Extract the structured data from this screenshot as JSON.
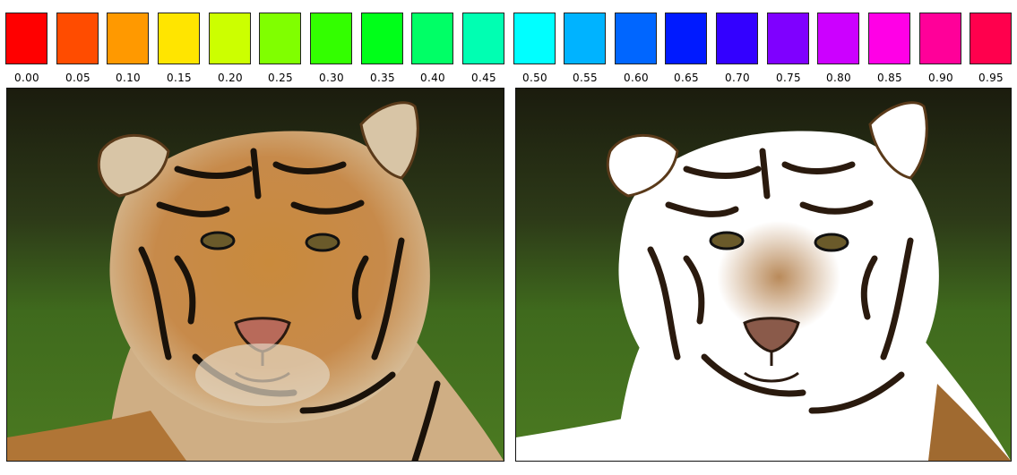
{
  "hue_swatches": [
    {
      "label": "0.00",
      "color": "#ff0000"
    },
    {
      "label": "0.05",
      "color": "#ff4c00"
    },
    {
      "label": "0.10",
      "color": "#ff9900"
    },
    {
      "label": "0.15",
      "color": "#ffe500"
    },
    {
      "label": "0.20",
      "color": "#ccff00"
    },
    {
      "label": "0.25",
      "color": "#80ff00"
    },
    {
      "label": "0.30",
      "color": "#33ff00"
    },
    {
      "label": "0.35",
      "color": "#00ff19"
    },
    {
      "label": "0.40",
      "color": "#00ff66"
    },
    {
      "label": "0.45",
      "color": "#00ffb2"
    },
    {
      "label": "0.50",
      "color": "#00ffff"
    },
    {
      "label": "0.55",
      "color": "#00b3ff"
    },
    {
      "label": "0.60",
      "color": "#0066ff"
    },
    {
      "label": "0.65",
      "color": "#001aff"
    },
    {
      "label": "0.70",
      "color": "#3300ff"
    },
    {
      "label": "0.75",
      "color": "#7f00ff"
    },
    {
      "label": "0.80",
      "color": "#cc00ff"
    },
    {
      "label": "0.85",
      "color": "#ff00e6"
    },
    {
      "label": "0.90",
      "color": "#ff0099"
    },
    {
      "label": "0.95",
      "color": "#ff004d"
    }
  ],
  "panels": {
    "left": {
      "description_icon": "tiger-photo-original"
    },
    "right": {
      "description_icon": "tiger-photo-hue-filtered"
    }
  }
}
